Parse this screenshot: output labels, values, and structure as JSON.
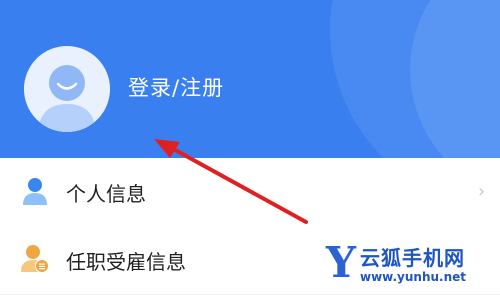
{
  "header": {
    "login_label": "登录/注册",
    "colors": {
      "background": "#3a7ff0",
      "text": "#ffffff"
    }
  },
  "menu": {
    "items": [
      {
        "label": "个人信息",
        "icon": "person-icon",
        "chevron": "›"
      },
      {
        "label": "任职受雇信息",
        "icon": "employment-badge-icon"
      }
    ]
  },
  "watermark": {
    "logo_letter": "Y",
    "name": "云狐手机网",
    "url": "www.yunhu.net"
  },
  "annotation": {
    "arrow_color": "#e02020"
  }
}
